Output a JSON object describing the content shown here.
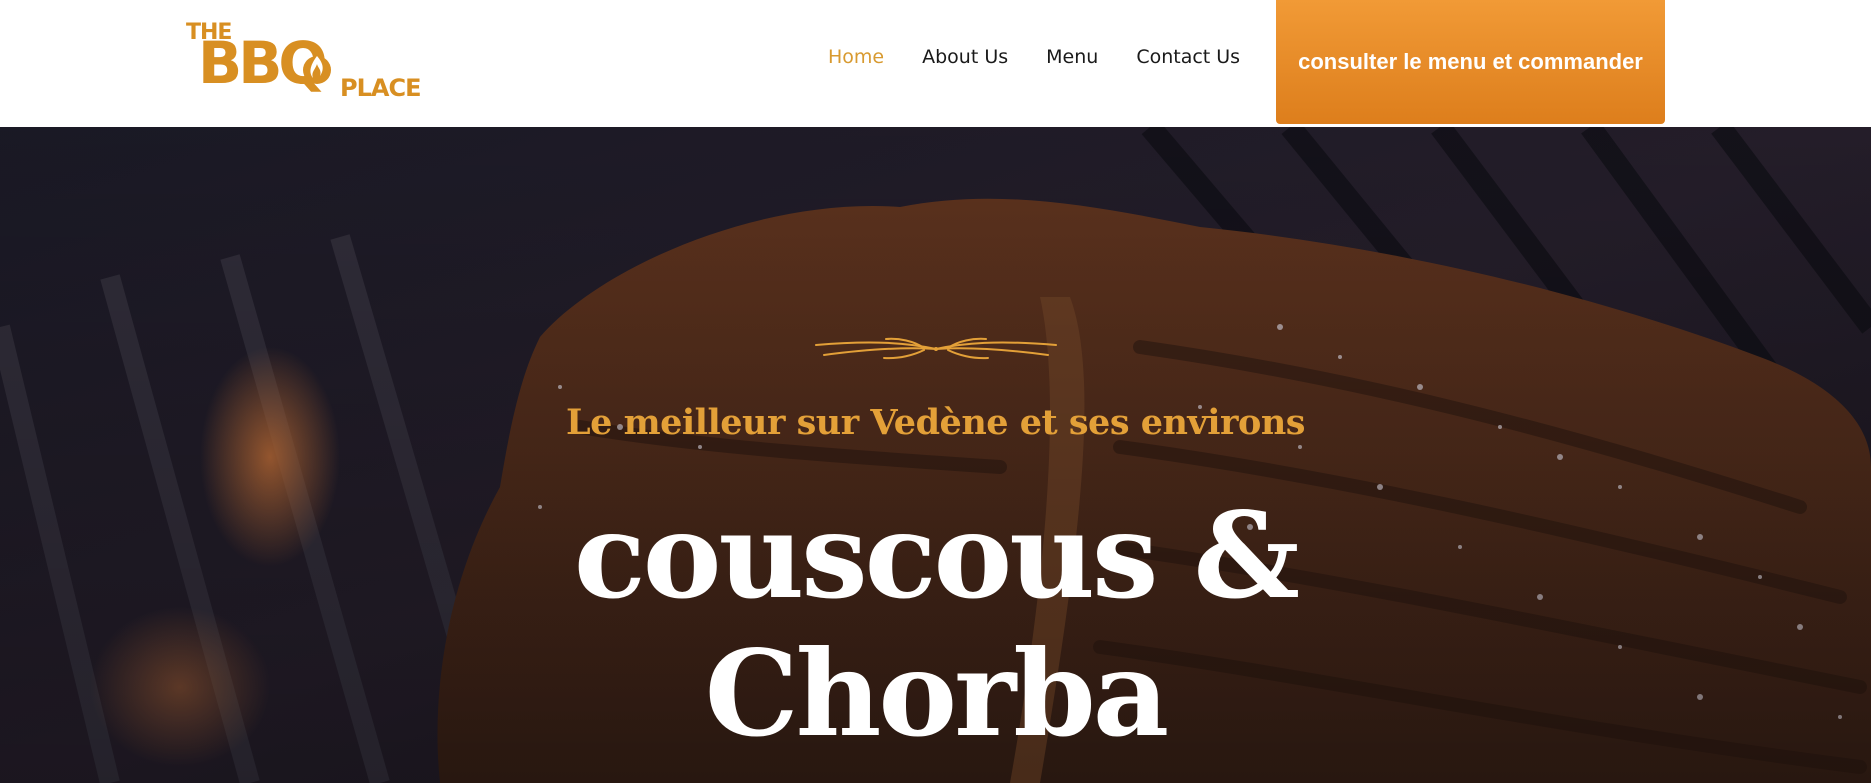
{
  "header": {
    "logo": {
      "line1": "THE",
      "line2": "BBQ",
      "line3": "PLACE"
    },
    "nav": [
      {
        "label": "Home",
        "active": true
      },
      {
        "label": "About Us",
        "active": false
      },
      {
        "label": "Menu",
        "active": false
      },
      {
        "label": "Contact Us",
        "active": false
      }
    ],
    "cta_label": "consulter le menu et commander"
  },
  "hero": {
    "eyebrow": "Le meilleur sur Vedène et ses environs",
    "headline_line1": "couscous &",
    "headline_line2": "Chorba",
    "background_description_icon": "grilled-steak-photo"
  },
  "colors": {
    "brand_orange": "#d88f22",
    "cta_orange": "#ec8f2c",
    "nav_active": "#d89a30",
    "eyebrow_gold": "#e3a038",
    "headline_white": "#ffffff"
  }
}
